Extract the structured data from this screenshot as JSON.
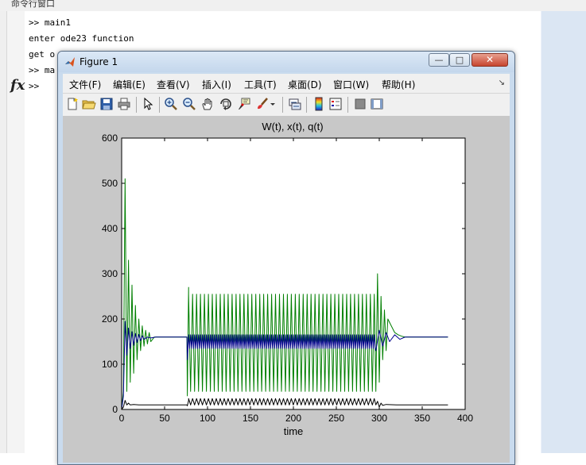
{
  "command_window": {
    "title": "命令行窗口",
    "lines": [
      ">> main1",
      "enter ode23 function",
      "get o",
      ">> ma",
      ">>"
    ]
  },
  "figure": {
    "title": "Figure 1",
    "controls": {
      "minimize": "—",
      "maximize": "□",
      "close": "✕"
    },
    "menus": [
      "文件(F)",
      "编辑(E)",
      "查看(V)",
      "插入(I)",
      "工具(T)",
      "桌面(D)",
      "窗口(W)",
      "帮助(H)"
    ],
    "menu_overflow": "↘",
    "toolbar": [
      "new-figure-icon",
      "open-file-icon",
      "save-icon",
      "print-icon",
      "select-arrow-icon",
      "zoom-in-icon",
      "zoom-out-icon",
      "pan-hand-icon",
      "rotate-3d-icon",
      "data-cursor-icon",
      "brush-icon",
      "link-plot-icon",
      "colorbar-icon",
      "legend-icon",
      "hide-plot-tools-icon",
      "show-plot-tools-icon"
    ]
  },
  "chart_data": {
    "type": "line",
    "title": "W(t), x(t), q(t)",
    "xlabel": "time",
    "ylabel": "",
    "xlim": [
      0,
      400
    ],
    "ylim": [
      0,
      600
    ],
    "xticks": [
      0,
      50,
      100,
      150,
      200,
      250,
      300,
      350,
      400
    ],
    "yticks": [
      0,
      100,
      200,
      300,
      400,
      500,
      600
    ],
    "grid": false,
    "legend": "none",
    "colors": {
      "green": "#007f00",
      "blue": "#00008b",
      "black": "#000000"
    },
    "series": [
      {
        "color": "green",
        "x": [
          0,
          2,
          4,
          6,
          8,
          10,
          12,
          14,
          16,
          18,
          20,
          22,
          24,
          26,
          28,
          30,
          32,
          34,
          38,
          50,
          76,
          76.5,
          78,
          80,
          296,
          298,
          300,
          302,
          304,
          306,
          308,
          310,
          314,
          318,
          322,
          326,
          330,
          340,
          380
        ],
        "y": [
          0,
          40,
          510,
          40,
          330,
          60,
          275,
          80,
          230,
          110,
          200,
          130,
          185,
          140,
          175,
          145,
          170,
          150,
          160,
          160,
          160,
          30,
          270,
          40,
          40,
          300,
          60,
          250,
          110,
          220,
          130,
          200,
          185,
          170,
          165,
          162,
          160,
          160,
          160
        ],
        "oscillation": {
          "from": 78,
          "to": 296,
          "period": 4.6,
          "low": 40,
          "high": 255
        }
      },
      {
        "color": "blue",
        "x": [
          0,
          2,
          4,
          6,
          8,
          10,
          12,
          14,
          16,
          18,
          20,
          22,
          24,
          26,
          30,
          34,
          40,
          50,
          76,
          76.5,
          78,
          80,
          296,
          300,
          304,
          308,
          312,
          318,
          324,
          330,
          340,
          380
        ],
        "y": [
          0,
          30,
          195,
          120,
          180,
          135,
          172,
          142,
          168,
          148,
          166,
          152,
          163,
          155,
          160,
          158,
          160,
          160,
          160,
          110,
          165,
          130,
          130,
          175,
          140,
          170,
          150,
          165,
          155,
          160,
          160,
          160
        ],
        "oscillation": {
          "from": 78,
          "to": 296,
          "period": 2.3,
          "low": 135,
          "high": 165
        }
      },
      {
        "color": "black",
        "x": [
          0,
          2,
          4,
          6,
          8,
          10,
          14,
          20,
          30,
          50,
          76,
          76.5,
          78,
          80,
          296,
          298,
          300,
          302,
          304,
          308,
          320,
          380
        ],
        "y": [
          0,
          5,
          20,
          10,
          14,
          10,
          11,
          10,
          10,
          10,
          10,
          8,
          20,
          10,
          10,
          18,
          5,
          14,
          9,
          11,
          10,
          10
        ],
        "oscillation": {
          "from": 78,
          "to": 296,
          "period": 4.6,
          "low": 10,
          "high": 24
        }
      }
    ]
  }
}
